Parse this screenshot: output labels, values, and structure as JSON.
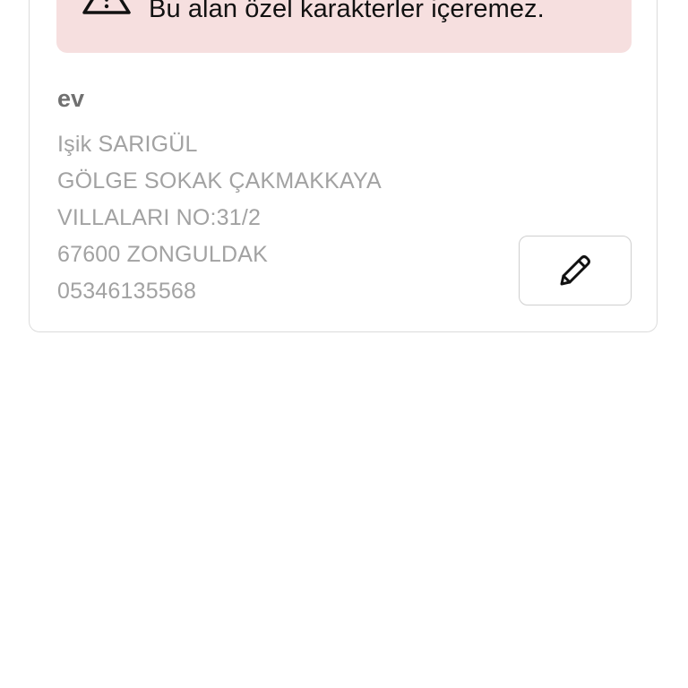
{
  "alert": {
    "message": "Bu alan özel karakterler içeremez.",
    "icon": "warning-triangle-icon",
    "background": "#f6dfdf"
  },
  "address": {
    "title": "ev",
    "name": "Işik SARIGÜL",
    "street_line1": "GÖLGE SOKAK ÇAKMAKKAYA",
    "street_line2": "VILLALARI NO:31/2",
    "postal_city": "67600 ZONGULDAK",
    "phone": "05346135568"
  },
  "edit_button": {
    "icon": "pencil-icon"
  }
}
